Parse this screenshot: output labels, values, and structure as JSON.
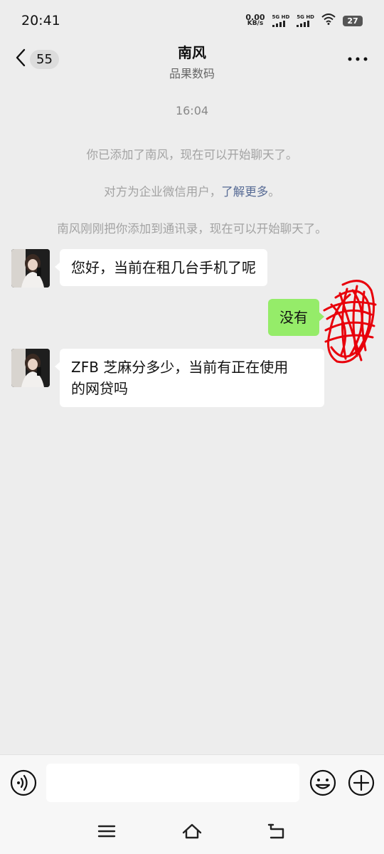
{
  "status_bar": {
    "time": "20:41",
    "net_speed_value": "0.00",
    "net_speed_unit": "KB/s",
    "sim1_label": "5G HD",
    "sim2_label": "5G HD",
    "battery": "27"
  },
  "header": {
    "back_badge": "55",
    "title": "南风",
    "subtitle": "品果数码",
    "more_icon": "more-dots-icon"
  },
  "chat": {
    "timestamp": "16:04",
    "system_messages": [
      {
        "text": "你已添加了南风，现在可以开始聊天了。"
      },
      {
        "text_prefix": "对方为企业微信用户，",
        "link": "了解更多",
        "text_suffix": "。"
      },
      {
        "text": "南风刚刚把你添加到通讯录，现在可以开始聊天了。"
      }
    ],
    "messages": [
      {
        "sender": "contact",
        "text": "您好，当前在租几台手机了呢"
      },
      {
        "sender": "me",
        "text": "没有"
      },
      {
        "sender": "contact",
        "line1": "ZFB 芝麻分多少，当前有正在使用",
        "line2": "的网贷吗"
      }
    ]
  },
  "input_bar": {
    "placeholder": "",
    "voice_icon": "voice-icon",
    "emoji_icon": "emoji-icon",
    "plus_icon": "plus-icon"
  },
  "nav_bar": {
    "menu_icon": "menu-icon",
    "home_icon": "home-icon",
    "back_icon": "back-icon"
  },
  "colors": {
    "background": "#ededed",
    "my_bubble": "#95ec69",
    "contact_bubble": "#ffffff",
    "link": "#576b95",
    "redaction": "#e8000b"
  }
}
